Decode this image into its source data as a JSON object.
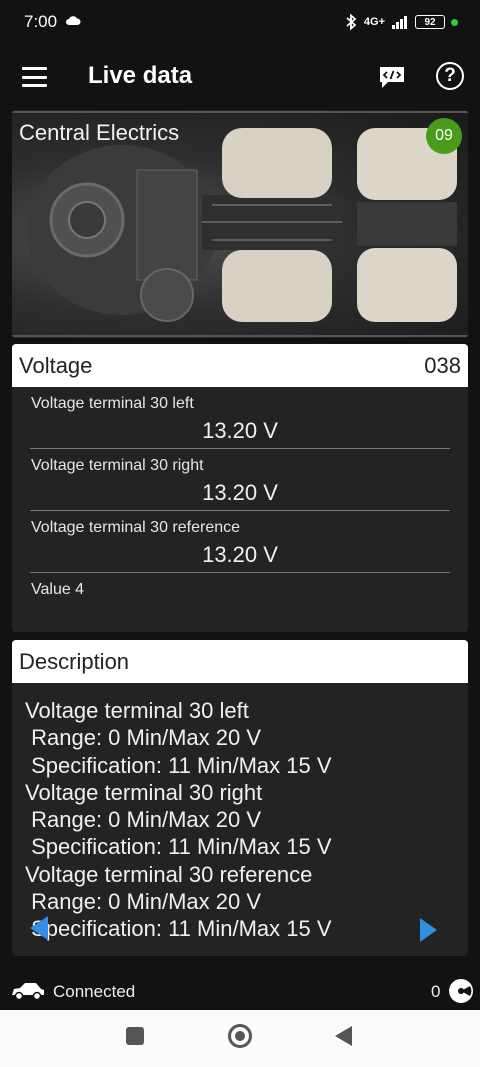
{
  "status_bar": {
    "time": "7:00",
    "network": "4G+",
    "battery": "92"
  },
  "app_bar": {
    "title": "Live data"
  },
  "module": {
    "name": "Central Electrics",
    "badge": "09"
  },
  "voltage_card": {
    "title": "Voltage",
    "number": "038",
    "rows": [
      {
        "label": "Voltage terminal 30 left",
        "value": "13.20 V"
      },
      {
        "label": "Voltage terminal 30 right",
        "value": "13.20 V"
      },
      {
        "label": "Voltage terminal 30 reference",
        "value": "13.20 V"
      },
      {
        "label": "Value 4",
        "value": ""
      }
    ]
  },
  "description_card": {
    "title": "Description",
    "lines": [
      "Voltage terminal 30 left",
      " Range: 0 Min/Max 20 V",
      " Specification: 11 Min/Max 15 V",
      "Voltage terminal 30 right",
      " Range: 0 Min/Max 20 V",
      " Specification: 11 Min/Max 15 V",
      "Voltage terminal 30 reference",
      " Range: 0 Min/Max 20 V",
      " Specification: 11 Min/Max 15 V"
    ]
  },
  "footer": {
    "connection_status": "Connected",
    "count": "0"
  },
  "colors": {
    "accent": "#2f8fe0",
    "badge": "#4a9a1c",
    "background": "#121212",
    "card": "#232323"
  }
}
